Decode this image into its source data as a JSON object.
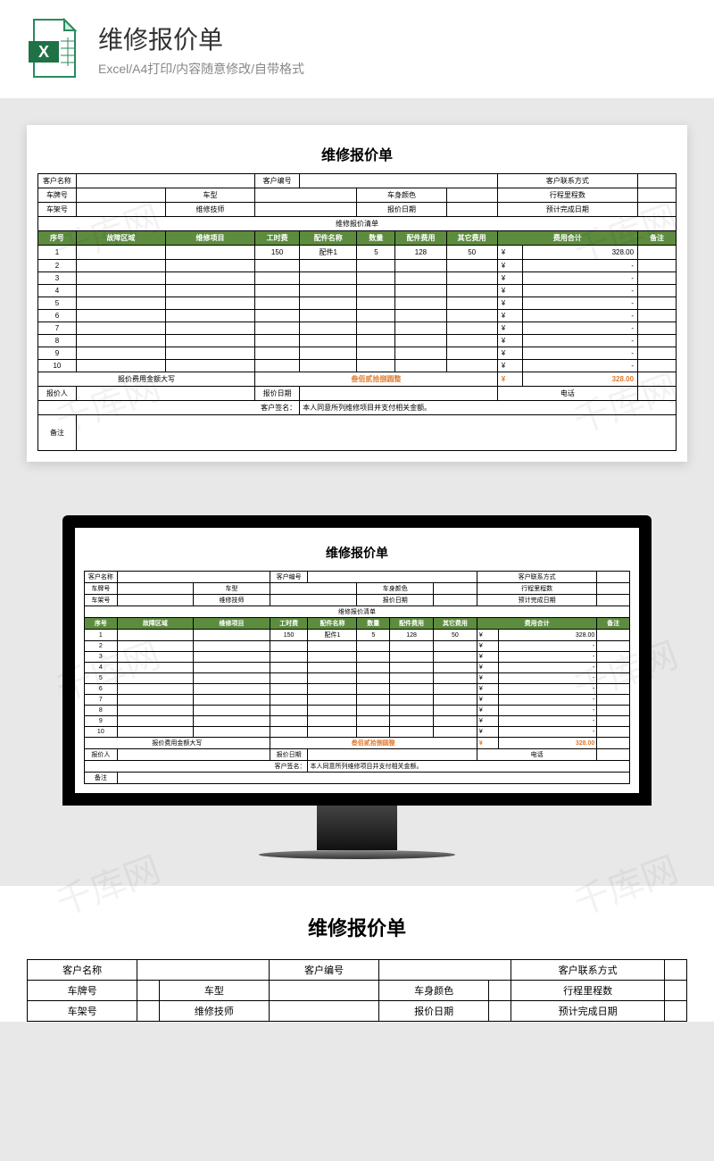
{
  "header": {
    "title": "维修报价单",
    "subtitle": "Excel/A4打印/内容随意修改/自带格式"
  },
  "doc": {
    "title": "维修报价单",
    "info_labels": {
      "customer_name": "客户名称",
      "customer_no": "客户编号",
      "customer_contact": "客户联系方式",
      "plate_no": "车牌号",
      "car_model": "车型",
      "car_color": "车身颜色",
      "mileage": "行程里程数",
      "vin": "车架号",
      "technician": "维修技师",
      "quote_date": "报价日期",
      "est_complete": "预计完成日期",
      "list_title": "维修报价清单"
    },
    "cols": {
      "seq": "序号",
      "fault_area": "故障区域",
      "repair_item": "维修项目",
      "labor_fee": "工时费",
      "part_name": "配件名称",
      "qty": "数量",
      "part_fee": "配件费用",
      "other_fee": "其它费用",
      "total_fee": "费用合计",
      "remark": "备注"
    },
    "rows": [
      {
        "seq": "1",
        "labor": "150",
        "part": "配件1",
        "qty": "5",
        "pfee": "128",
        "ofee": "50",
        "cur": "¥",
        "total": "328.00"
      },
      {
        "seq": "2",
        "cur": "¥",
        "total": "-"
      },
      {
        "seq": "3",
        "cur": "¥",
        "total": "-"
      },
      {
        "seq": "4",
        "cur": "¥",
        "total": "-"
      },
      {
        "seq": "5",
        "cur": "¥",
        "total": "-"
      },
      {
        "seq": "6",
        "cur": "¥",
        "total": "-"
      },
      {
        "seq": "7",
        "cur": "¥",
        "total": "-"
      },
      {
        "seq": "8",
        "cur": "¥",
        "total": "-"
      },
      {
        "seq": "9",
        "cur": "¥",
        "total": "-"
      },
      {
        "seq": "10",
        "cur": "¥",
        "total": "-"
      }
    ],
    "footer": {
      "amount_words_label": "报价费用金额大写",
      "amount_words": "叁佰贰拾捌圆整",
      "grand_cur": "¥",
      "grand_total": "328.00",
      "quoter": "报价人",
      "quote_date": "报价日期",
      "phone": "电话",
      "sign_label": "客户签名：",
      "sign_note": "本人同意所列维修项目并支付相关金额。",
      "remark": "备注"
    }
  },
  "watermark": "千库网"
}
